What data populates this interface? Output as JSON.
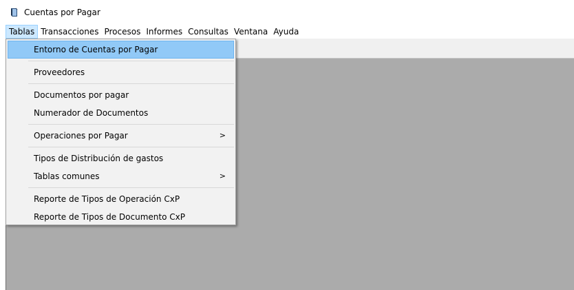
{
  "window": {
    "title": "Cuentas por Pagar",
    "icon": "book-icon"
  },
  "menubar": {
    "items": [
      {
        "label": "Tablas"
      },
      {
        "label": "Transacciones"
      },
      {
        "label": "Procesos"
      },
      {
        "label": "Informes"
      },
      {
        "label": "Consultas"
      },
      {
        "label": "Ventana"
      },
      {
        "label": "Ayuda"
      }
    ]
  },
  "dropdown": {
    "items": [
      {
        "label": "Entorno de Cuentas por Pagar"
      },
      {
        "label": "Proveedores"
      },
      {
        "label": "Documentos por pagar"
      },
      {
        "label": "Numerador de Documentos"
      },
      {
        "label": "Operaciones por Pagar",
        "submenu": ">"
      },
      {
        "label": "Tipos de Distribución de gastos"
      },
      {
        "label": "Tablas comunes",
        "submenu": ">"
      },
      {
        "label": "Reporte de Tipos de Operación CxP"
      },
      {
        "label": "Reporte de Tipos de Documento CxP"
      }
    ]
  },
  "colors": {
    "menu_highlight": "#91c9f7",
    "mdi_background": "#ababab",
    "active_menu": "#cce8ff"
  }
}
